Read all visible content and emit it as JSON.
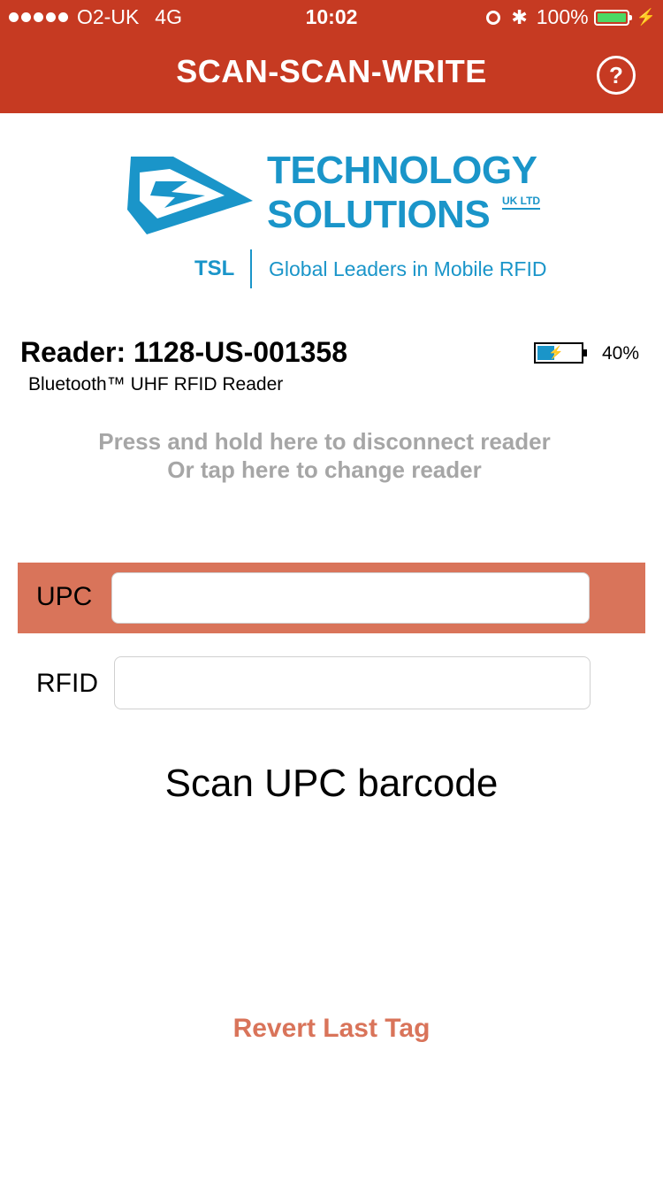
{
  "status_bar": {
    "carrier": "O2-UK",
    "network": "4G",
    "time": "10:02",
    "battery_percent": "100%"
  },
  "nav": {
    "title": "SCAN-SCAN-WRITE",
    "help_label": "?"
  },
  "logo": {
    "line1": "TECHNOLOGY",
    "line2": "SOLUTIONS",
    "uk_ltd": "UK LTD",
    "tsl": "TSL",
    "tagline": "Global Leaders in Mobile RFID"
  },
  "reader": {
    "name": "Reader: 1128-US-001358",
    "type": "Bluetooth™ UHF RFID Reader",
    "battery_percent": "40%",
    "battery_level": 0.4
  },
  "hints": {
    "line1": "Press and hold here to disconnect reader",
    "line2": "Or tap here to change reader"
  },
  "form": {
    "upc_label": "UPC",
    "upc_value": "",
    "rfid_label": "RFID",
    "rfid_value": ""
  },
  "instruction": "Scan UPC barcode",
  "revert_label": "Revert Last Tag",
  "colors": {
    "nav_bg": "#c63a22",
    "accent": "#d9745a",
    "logo_blue": "#1a95c9",
    "hint_gray": "#a6a6a6"
  }
}
